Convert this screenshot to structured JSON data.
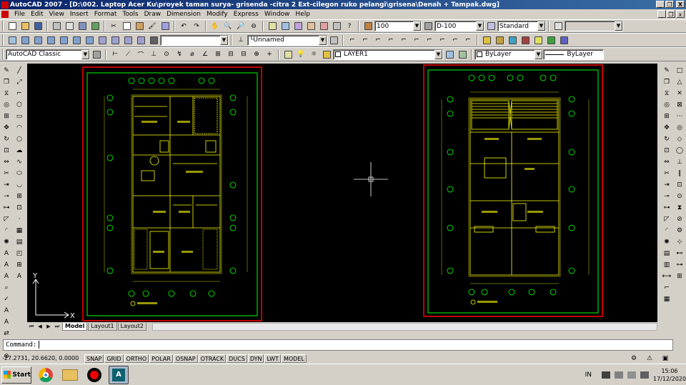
{
  "window": {
    "title": "AutoCAD 2007 - [D:\\002. Laptop Acer Ku\\proyek taman surya- grisenda -citra 2 Ext-cilegon ruko pelangi\\grisena\\Denah + Tampak.dwg]",
    "minimize": "_",
    "restore": "❐",
    "close": "X"
  },
  "menu": {
    "items": [
      "File",
      "Edit",
      "View",
      "Insert",
      "Format",
      "Tools",
      "Draw",
      "Dimension",
      "Modify",
      "Express",
      "Window",
      "Help"
    ],
    "mdi_min": "_",
    "mdi_restore": "❐",
    "mdi_close": "x"
  },
  "toolbars": {
    "dimscale": "100",
    "dimstyle": "D-100",
    "textstyle": "Standard",
    "view_name": "Unnamed",
    "workspace": "AutoCAD Classic",
    "layer": "LAYER1",
    "color": "ByLayer",
    "linetype": "ByLayer"
  },
  "layout_tabs": [
    "Model",
    "Layout1",
    "Layout2"
  ],
  "ucs": {
    "x_label": "X",
    "y_label": "Y"
  },
  "command": {
    "prompt": "Command:"
  },
  "status": {
    "coords": "-27.2731, 20.6620, 0.0000",
    "toggles": [
      "SNAP",
      "GRID",
      "ORTHO",
      "POLAR",
      "OSNAP",
      "OTRACK",
      "DUCS",
      "DYN",
      "LWT",
      "MODEL"
    ]
  },
  "taskbar": {
    "start_label": "Start",
    "apps": [
      "chrome-icon",
      "folder-icon",
      "record-icon",
      "autocad-icon"
    ],
    "language": "IN",
    "time": "15:06",
    "date": "17/12/2020"
  },
  "colors": {
    "title_start": "#0a246a",
    "title_end": "#3a6ea5",
    "canvas": "#000000",
    "drawing_lines": "#ffff00",
    "grid_bubbles": "#00ff00",
    "sheet_frame": "#ff0000"
  }
}
